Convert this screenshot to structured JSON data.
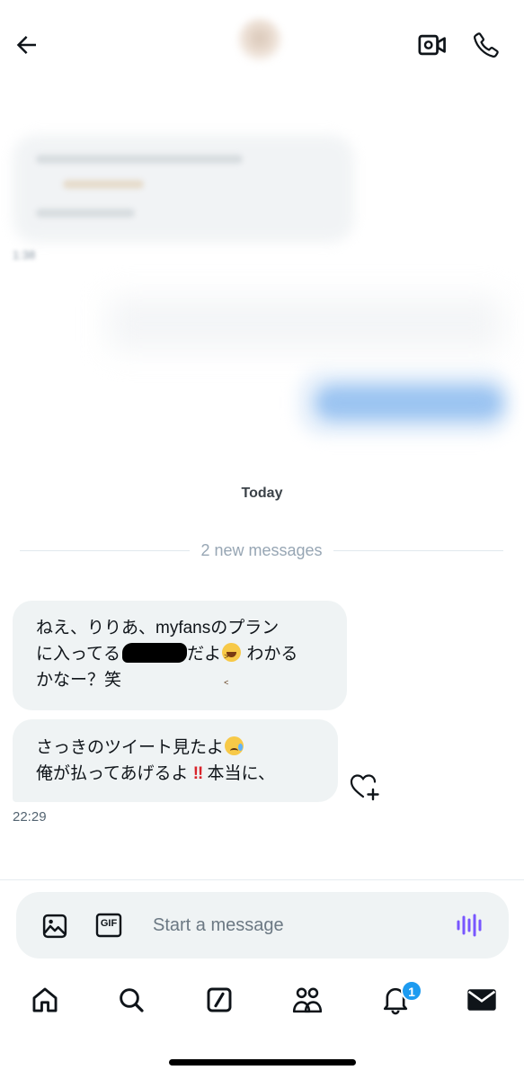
{
  "header": {
    "back_icon": "arrow-left-icon",
    "video_icon": "video-camera-icon",
    "phone_icon": "phone-icon"
  },
  "conversation": {
    "earlier_time": "1:38",
    "today_label": "Today",
    "new_messages_label": "2 new messages",
    "messages": [
      {
        "line1": "ねえ、りりあ、myfansのプラン",
        "line2a": "に入ってる",
        "line2b": "だよ",
        "line2c": " わかる",
        "line3": "かなー？笑"
      },
      {
        "line1a": "さっきのツイート見たよ",
        "line2a": "俺が払ってあげるよ ",
        "line2b": "‼",
        "line2c": " 本当に、"
      }
    ],
    "last_time": "22:29"
  },
  "composer": {
    "placeholder": "Start a message",
    "gif_label": "GIF"
  },
  "nav": {
    "items": [
      "home-icon",
      "search-icon",
      "compose-icon",
      "communities-icon",
      "notifications-icon",
      "messages-icon"
    ],
    "notification_count": "1"
  },
  "colors": {
    "accent": "#1d9bf0",
    "bubble_bg": "#eff3f4",
    "voice_icon": "#7856ff"
  }
}
